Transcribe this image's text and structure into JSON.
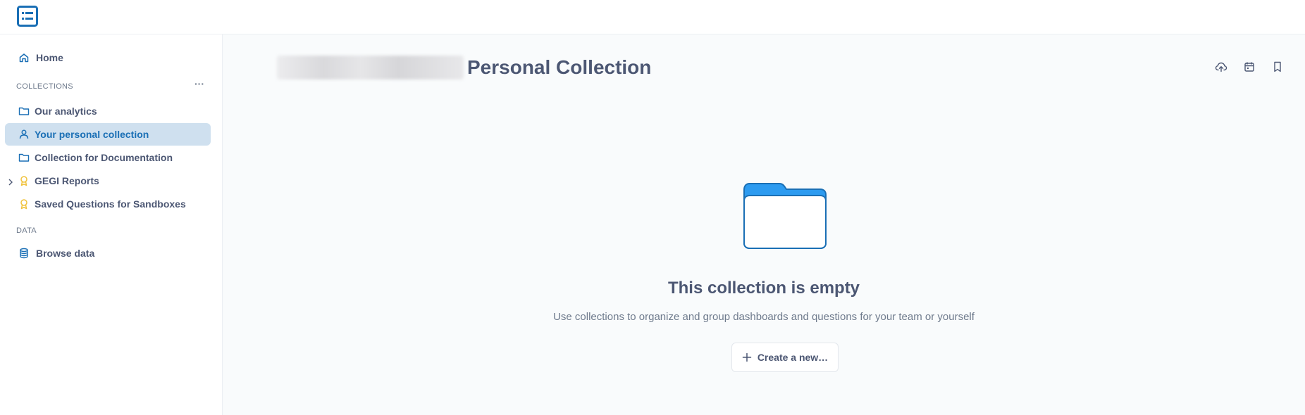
{
  "topbar": {
    "logo_icon": "metabase-collection-logo-icon"
  },
  "sidebar": {
    "home_label": "Home",
    "collections_section": "COLLECTIONS",
    "more_label": "···",
    "items": [
      {
        "label": "Our analytics",
        "icon": "folder-icon"
      },
      {
        "label": "Your personal collection",
        "icon": "person-icon",
        "active": true
      },
      {
        "label": "Collection for Documentation",
        "icon": "folder-icon"
      },
      {
        "label": "GEGI Reports",
        "icon": "badge-icon",
        "expandable": true
      },
      {
        "label": "Saved Questions for Sandboxes",
        "icon": "badge-icon"
      }
    ],
    "data_section": "DATA",
    "browse_label": "Browse data"
  },
  "main": {
    "title": "Personal Collection",
    "header_icons": [
      "upload-icon",
      "calendar-icon",
      "bookmark-icon"
    ],
    "empty": {
      "title": "This collection is empty",
      "description": "Use collections to organize and group dashboards and questions for your team or yourself",
      "button_label": "Create a new…"
    }
  },
  "colors": {
    "accent": "#1a6fb5",
    "active_bg": "#cfe0ef",
    "badge": "#f0c23b",
    "folder_blue": "#2d9bf0"
  }
}
